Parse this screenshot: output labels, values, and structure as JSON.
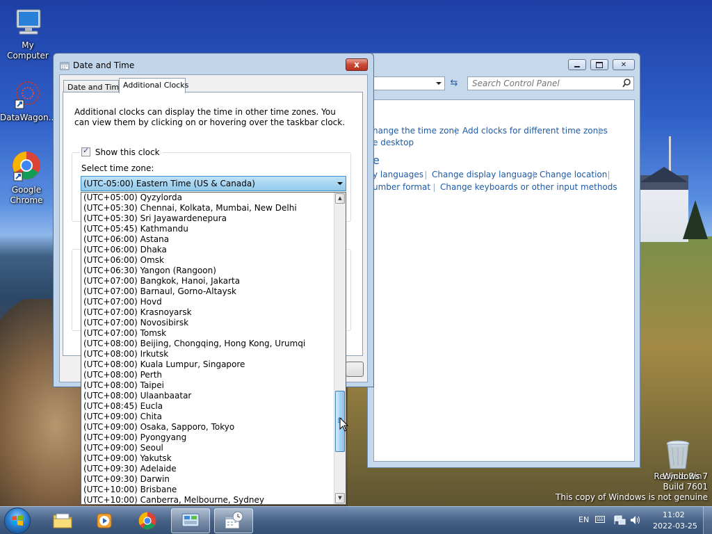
{
  "desktop": {
    "icons": [
      {
        "label": "My Computer"
      },
      {
        "label": "DataWagon..."
      },
      {
        "label": "Google Chrome"
      },
      {
        "label": "Recycle Bin"
      }
    ],
    "watermark": {
      "line1": "Windows 7",
      "line2": "Build 7601",
      "line3": "This copy of Windows is not genuine"
    }
  },
  "control_panel": {
    "search_placeholder": "Search Control Panel",
    "links": {
      "change_time_zone": "hange the time zone",
      "add_clocks": "Add clocks for different time zones",
      "desktop": "e desktop",
      "heading_fragment": "e",
      "languages": "y languages",
      "change_display_language": "Change display language",
      "change_location": "Change location",
      "number_format": "umber format",
      "change_keyboards": "Change keyboards or other input methods"
    }
  },
  "dialog": {
    "title": "Date and Time",
    "close_label": "x",
    "tabs": [
      {
        "label": "Date and Time"
      },
      {
        "label": "Additional Clocks"
      }
    ],
    "description": "Additional clocks can display the time in other time zones. You can view them by clicking on or hovering over the taskbar clock.",
    "show_clock_label": "Show this clock",
    "show_clock_checked": true,
    "select_time_zone_label": "Select time zone:",
    "selected_time_zone": "(UTC-05:00) Eastern Time (US & Canada)",
    "time_zone_options": [
      "(UTC+05:00) Qyzylorda",
      "(UTC+05:30) Chennai, Kolkata, Mumbai, New Delhi",
      "(UTC+05:30) Sri Jayawardenepura",
      "(UTC+05:45) Kathmandu",
      "(UTC+06:00) Astana",
      "(UTC+06:00) Dhaka",
      "(UTC+06:00) Omsk",
      "(UTC+06:30) Yangon (Rangoon)",
      "(UTC+07:00) Bangkok, Hanoi, Jakarta",
      "(UTC+07:00) Barnaul, Gorno-Altaysk",
      "(UTC+07:00) Hovd",
      "(UTC+07:00) Krasnoyarsk",
      "(UTC+07:00) Novosibirsk",
      "(UTC+07:00) Tomsk",
      "(UTC+08:00) Beijing, Chongqing, Hong Kong, Urumqi",
      "(UTC+08:00) Irkutsk",
      "(UTC+08:00) Kuala Lumpur, Singapore",
      "(UTC+08:00) Perth",
      "(UTC+08:00) Taipei",
      "(UTC+08:00) Ulaanbaatar",
      "(UTC+08:45) Eucla",
      "(UTC+09:00) Chita",
      "(UTC+09:00) Osaka, Sapporo, Tokyo",
      "(UTC+09:00) Pyongyang",
      "(UTC+09:00) Seoul",
      "(UTC+09:00) Yakutsk",
      "(UTC+09:30) Adelaide",
      "(UTC+09:30) Darwin",
      "(UTC+10:00) Brisbane",
      "(UTC+10:00) Canberra, Melbourne, Sydney"
    ]
  },
  "taskbar": {
    "language": "EN",
    "time": "11:02",
    "date": "2022-03-25"
  },
  "colors": {
    "link": "#1e5aa6",
    "selection": "#92c9ec",
    "close_button": "#c94a36"
  }
}
